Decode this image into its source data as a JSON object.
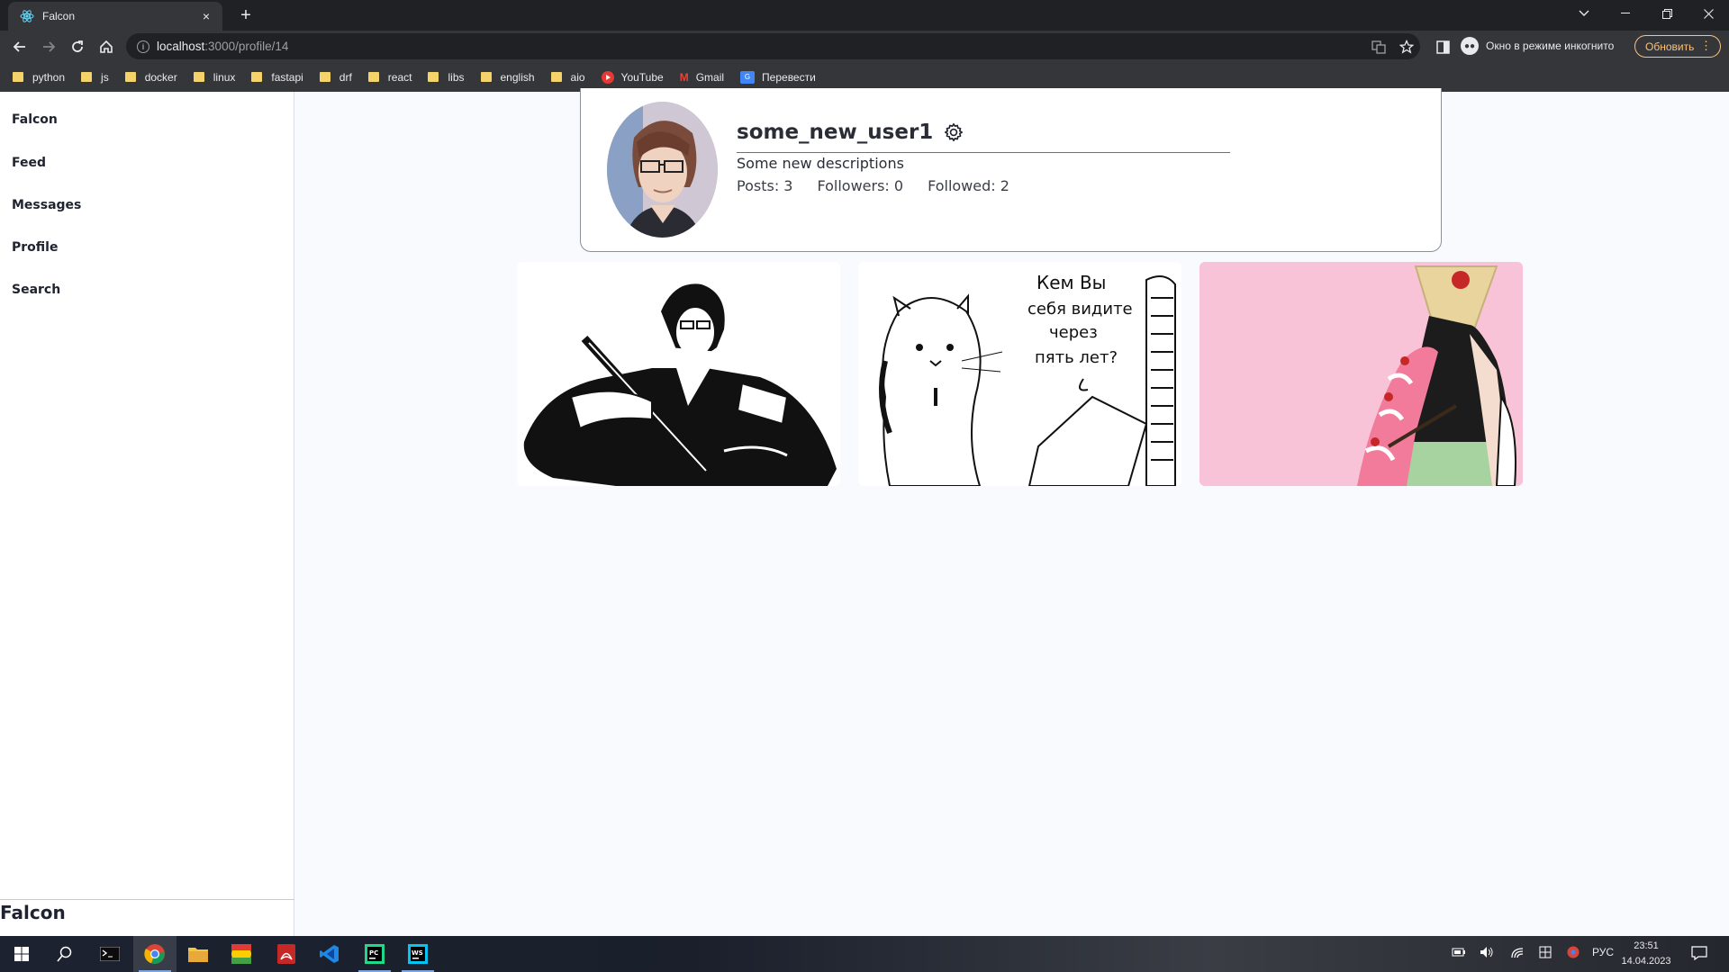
{
  "browser": {
    "tab_title": "Falcon",
    "tab_close": "×",
    "new_tab": "+",
    "url_host": "localhost",
    "url_path": ":3000/profile/14",
    "incognito_label": "Окно в режиме инкогнито",
    "update_label": "Обновить",
    "bookmarks": [
      {
        "label": "python",
        "icon": "folder-icon"
      },
      {
        "label": "js",
        "icon": "folder-icon"
      },
      {
        "label": "docker",
        "icon": "folder-icon"
      },
      {
        "label": "linux",
        "icon": "folder-icon"
      },
      {
        "label": "fastapi",
        "icon": "folder-icon"
      },
      {
        "label": "drf",
        "icon": "folder-icon"
      },
      {
        "label": "react",
        "icon": "folder-icon"
      },
      {
        "label": "libs",
        "icon": "folder-icon"
      },
      {
        "label": "english",
        "icon": "folder-icon"
      },
      {
        "label": "aio",
        "icon": "folder-icon"
      },
      {
        "label": "YouTube",
        "icon": "youtube-icon"
      },
      {
        "label": "Gmail",
        "icon": "gmail-icon"
      },
      {
        "label": "Перевести",
        "icon": "translate-icon"
      }
    ]
  },
  "sidebar": {
    "items": [
      {
        "label": "Falcon"
      },
      {
        "label": "Feed"
      },
      {
        "label": "Messages"
      },
      {
        "label": "Profile"
      },
      {
        "label": "Search"
      }
    ],
    "footer": "Falcon"
  },
  "profile": {
    "username": "some_new_user1",
    "description": "Some new descriptions",
    "posts": "Posts: 3",
    "followers": "Followers: 0",
    "followed": "Followed: 2"
  },
  "posts": [
    {
      "alt": "manga character drawing with sword"
    },
    {
      "alt": "hamster sketch comic",
      "caption_lines": [
        "Кем Вы",
        "себя видите",
        "через",
        "пять лет?"
      ]
    },
    {
      "alt": "pink illustration of character in kimono"
    }
  ],
  "taskbar": {
    "lang": "РУС",
    "time": "23:51",
    "date": "14.04.2023"
  },
  "colors": {
    "accent_update": "#f9c37d",
    "post3_bg": "#f8c3d6"
  }
}
